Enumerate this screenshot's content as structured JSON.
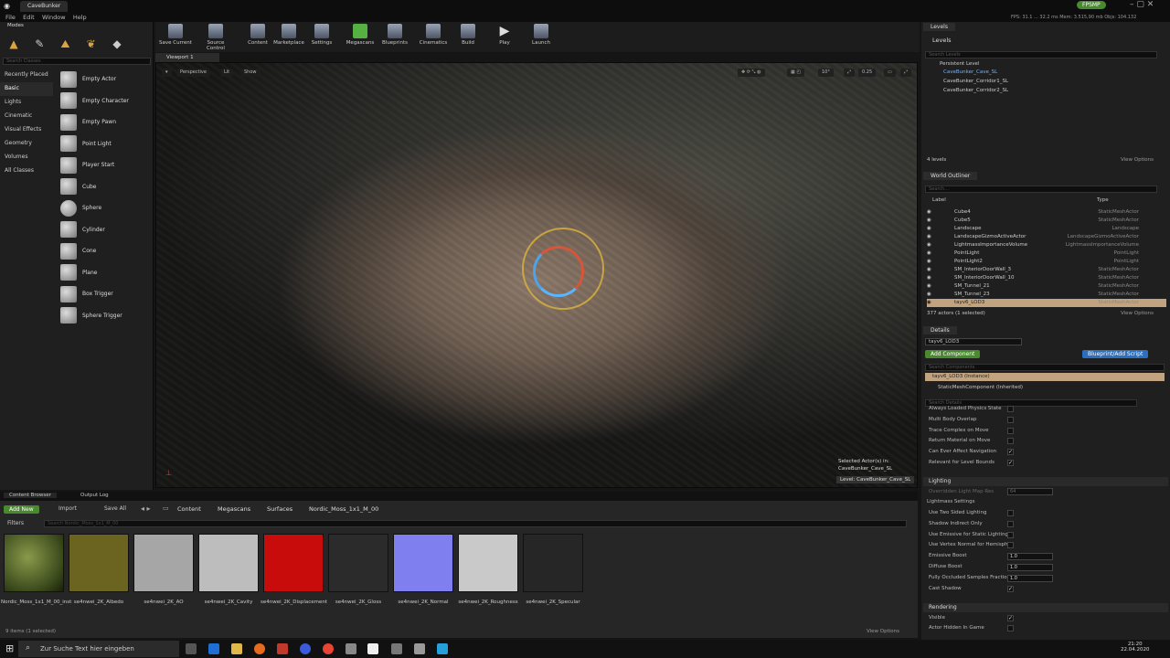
{
  "title_bar": {
    "tab": "CaveBunker",
    "app_badge": "FPSMP"
  },
  "menu": [
    "File",
    "Edit",
    "Window",
    "Help"
  ],
  "fps_readout": "FPS: 31.1 ... 32.2 ms  Mem: 3.515,90 mb  Objs: 104.132",
  "modes": {
    "tab": "Modes",
    "search_placeholder": "Search Classes",
    "categories": [
      "Recently Placed",
      "Basic",
      "Lights",
      "Cinematic",
      "Visual Effects",
      "Geometry",
      "Volumes",
      "All Classes"
    ],
    "items": [
      "Empty Actor",
      "Empty Character",
      "Empty Pawn",
      "Point Light",
      "Player Start",
      "Cube",
      "Sphere",
      "Cylinder",
      "Cone",
      "Plane",
      "Box Trigger",
      "Sphere Trigger"
    ]
  },
  "toolbar": {
    "buttons": [
      "Save Current",
      "Source Control",
      "Content",
      "Marketplace",
      "Settings",
      "Megascans",
      "Blueprints",
      "Cinematics",
      "Build",
      "Play",
      "Launch"
    ]
  },
  "viewport": {
    "tab": "Viewport 1",
    "buttons": [
      "Perspective",
      "Lit",
      "Show"
    ],
    "grid_value": "10°",
    "snap_value": "0.25",
    "selected_actor_line1": "Selected Actor(s) in:",
    "selected_actor_line2": "CaveBunker_Cave_SL",
    "level_badge": "Level: CaveBunker_Cave_SL"
  },
  "content_browser": {
    "tabs": [
      "Content Browser",
      "Output Log"
    ],
    "add_new": "Add New",
    "import": "Import",
    "save_all": "Save All",
    "breadcrumbs": [
      "Content",
      "Megascans",
      "Surfaces",
      "Nordic_Moss_1x1_M_00"
    ],
    "filters": "Filters",
    "search_placeholder": "Search Nordic_Moss_1x1_M_00",
    "assets": [
      {
        "label": "Nordic_Moss_1x1_M_00_inst",
        "color": "#556b2f"
      },
      {
        "label": "se4nwei_2K_Albedo",
        "color": "#6b6320"
      },
      {
        "label": "se4nwei_2K_AO",
        "color": "#a6a6a6"
      },
      {
        "label": "se4nwei_2K_Cavity",
        "color": "#bdbdbd"
      },
      {
        "label": "se4nwei_2K_Displacement",
        "color": "#c80c0c"
      },
      {
        "label": "se4nwei_2K_Gloss",
        "color": "#2b2b2b"
      },
      {
        "label": "se4nwei_2K_Normal",
        "color": "#7f7fef"
      },
      {
        "label": "se4nwei_2K_Roughness",
        "color": "#c9c9c9"
      },
      {
        "label": "se4nwei_2K_Specular",
        "color": "#262626"
      }
    ],
    "status": "9 items (1 selected)",
    "view_options": "View Options"
  },
  "levels": {
    "tab": "Levels",
    "menu": "Levels",
    "search_placeholder": "Search Levels",
    "items": [
      "Persistent Level",
      "CaveBunker_Cave_SL",
      "CaveBunker_Corridor1_SL",
      "CaveBunker_Corridor2_SL"
    ],
    "count": "4 levels",
    "view_options": "View Options"
  },
  "outliner": {
    "tab": "World Outliner",
    "search_placeholder": "Search...",
    "col_label": "Label",
    "col_type": "Type",
    "rows": [
      {
        "label": "Cube4",
        "type": "StaticMeshActor"
      },
      {
        "label": "Cube5",
        "type": "StaticMeshActor"
      },
      {
        "label": "Landscape",
        "type": "Landscape"
      },
      {
        "label": "LandscapeGizmoActiveActor",
        "type": "LandscapeGizmoActiveActor"
      },
      {
        "label": "LightmassImportanceVolume",
        "type": "LightmassImportanceVolume"
      },
      {
        "label": "PointLight",
        "type": "PointLight"
      },
      {
        "label": "PointLight2",
        "type": "PointLight"
      },
      {
        "label": "SM_InteriorDoorWall_3",
        "type": "StaticMeshActor"
      },
      {
        "label": "SM_InteriorDoorWall_10",
        "type": "StaticMeshActor"
      },
      {
        "label": "SM_Tunnel_21",
        "type": "StaticMeshActor"
      },
      {
        "label": "SM_Tunnel_23",
        "type": "StaticMeshActor"
      },
      {
        "label": "tayv6_LOD3",
        "type": "StaticMeshActor"
      }
    ],
    "count": "377 actors (1 selected)",
    "view_options": "View Options"
  },
  "details": {
    "tab": "Details",
    "name": "tayv6_LOD3",
    "add_component": "Add Component",
    "blueprint_script": "Blueprint/Add Script",
    "search_components": "Search Components",
    "instance": "tayv6_LOD3 (Instance)",
    "component": "StaticMeshComponent (Inherited)",
    "search_details": "Search Details",
    "props_top": [
      {
        "label": "Always Loaded Physics State",
        "checked": false
      },
      {
        "label": "Multi Body Overlap",
        "checked": false
      },
      {
        "label": "Trace Complex on Move",
        "checked": false
      },
      {
        "label": "Return Material on Move",
        "checked": false
      },
      {
        "label": "Can Ever Affect Navigation",
        "checked": true
      },
      {
        "label": "Relevant for Level Bounds",
        "checked": true
      }
    ],
    "lighting_section": "Lighting",
    "overridden_light_map": "Overridden Light Map Res",
    "overridden_light_map_value": "64",
    "lightmass_settings": "Lightmass Settings",
    "lightmass_props": [
      {
        "label": "Use Two Sided Lighting",
        "checked": false
      },
      {
        "label": "Shadow Indirect Only",
        "checked": false
      },
      {
        "label": "Use Emissive for Static Lighting",
        "checked": false
      },
      {
        "label": "Use Vertex Normal for Hemisph",
        "checked": false
      }
    ],
    "value_props": [
      {
        "label": "Emissive Boost",
        "value": "1.0"
      },
      {
        "label": "Diffuse Boost",
        "value": "1.0"
      },
      {
        "label": "Fully Occluded Samples Fractio",
        "value": "1.0"
      }
    ],
    "cast_shadow": "Cast Shadow",
    "rendering_section": "Rendering",
    "visible": "Visible",
    "actor_hidden": "Actor Hidden In Game"
  },
  "taskbar": {
    "search_placeholder": "Zur Suche Text hier eingeben",
    "time": "21:20",
    "date": "22.04.2020"
  }
}
